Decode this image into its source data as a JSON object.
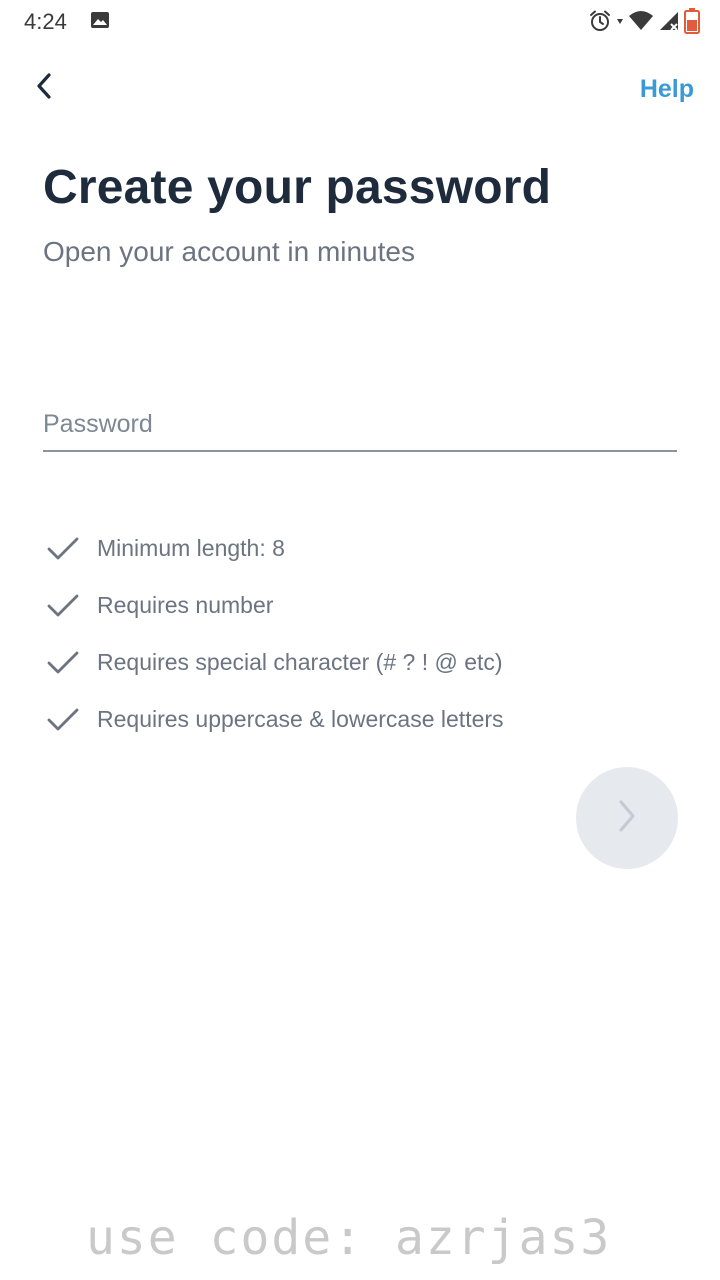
{
  "status_bar": {
    "time": "4:24",
    "icons": [
      "photo-icon",
      "alarm-icon",
      "wifi-icon",
      "signal-icon",
      "battery-icon"
    ],
    "battery_color": "#e25b3c"
  },
  "nav": {
    "back_icon": "chevron-left-icon",
    "help_label": "Help"
  },
  "header": {
    "title": "Create your password",
    "subtitle": "Open your account in minutes"
  },
  "form": {
    "password_placeholder": "Password",
    "password_value": ""
  },
  "requirements": [
    {
      "label": "Minimum length: 8",
      "icon": "check-icon"
    },
    {
      "label": "Requires number",
      "icon": "check-icon"
    },
    {
      "label": "Requires special character (# ? ! @ etc)",
      "icon": "check-icon"
    },
    {
      "label": "Requires uppercase & lowercase letters",
      "icon": "check-icon"
    }
  ],
  "next_button": {
    "icon": "chevron-right-icon",
    "enabled": false
  },
  "watermark": "use code: azrjas3",
  "colors": {
    "accent": "#3b9ad6",
    "title": "#1d2b3c",
    "muted": "#6b7480",
    "disabled_button": "#e6eaee"
  }
}
